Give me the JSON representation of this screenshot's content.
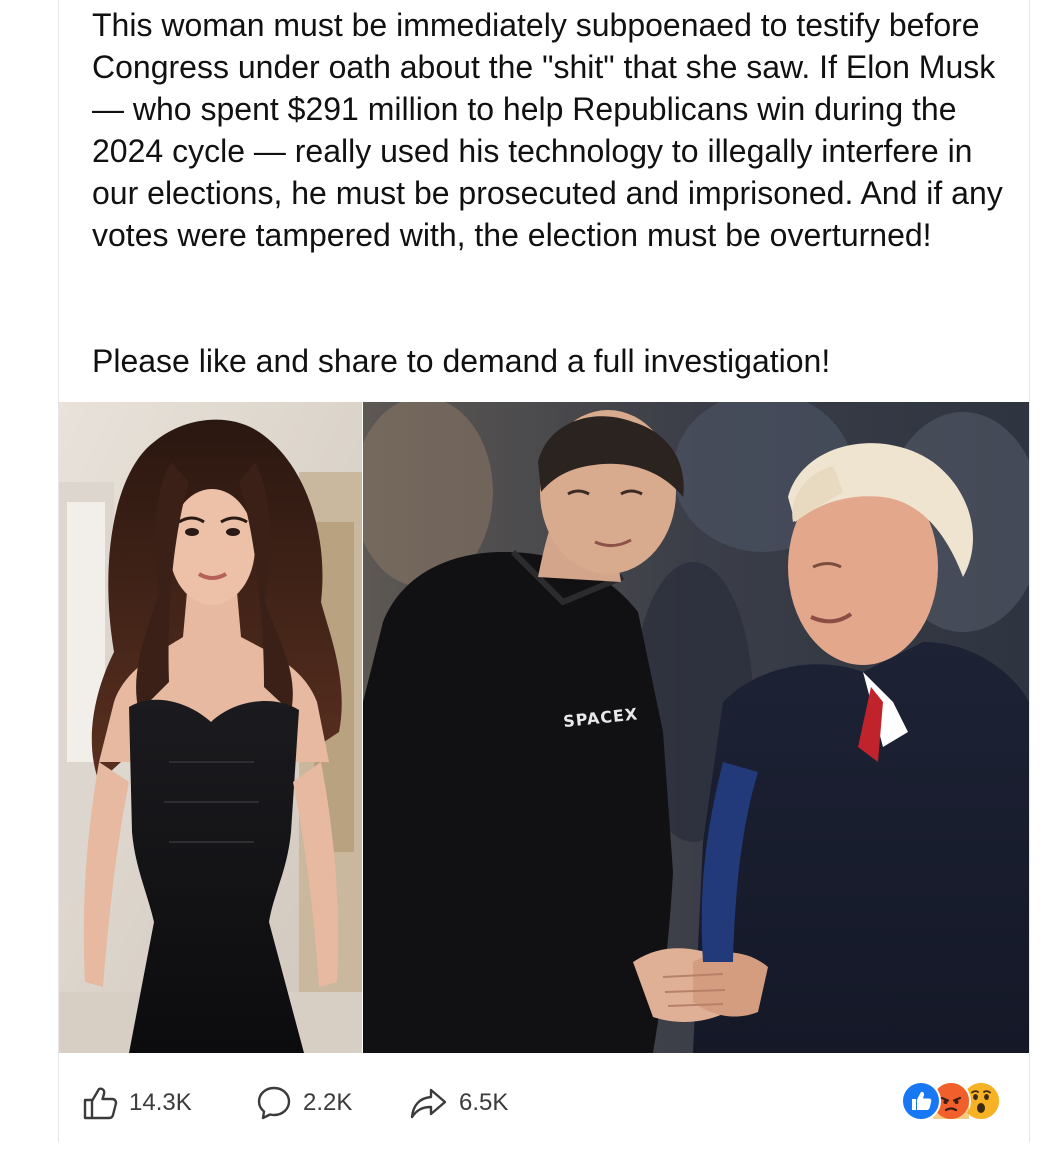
{
  "post": {
    "body": "This woman must be immediately subpoenaed to testify before Congress under oath about the \"shit\" that she saw. If Elon Musk — who spent $291 million to help Republicans win during the 2024 cycle — really used his technology to illegally interfere in our elections, he must be prosecuted and imprisoned. And if any votes were tampered with, the election must be overturned!",
    "call_to_action": "Please like and share to demand a full investigation!"
  },
  "photos": {
    "left_icon": "woman-portrait-photo",
    "right_icon": "handshake-photo",
    "hoodie_text": "SPACEX"
  },
  "actions": {
    "like_count": "14.3K",
    "comment_count": "2.2K",
    "share_count": "6.5K"
  },
  "reactions": [
    {
      "icon": "like-reaction-icon",
      "color": "#1877f2"
    },
    {
      "icon": "angry-reaction-icon",
      "color": "#e9710f"
    },
    {
      "icon": "wow-reaction-icon",
      "color": "#f7b125"
    }
  ],
  "colors": {
    "text": "#111111",
    "meta_text": "#3a3b3c",
    "border": "#e4e6eb"
  }
}
